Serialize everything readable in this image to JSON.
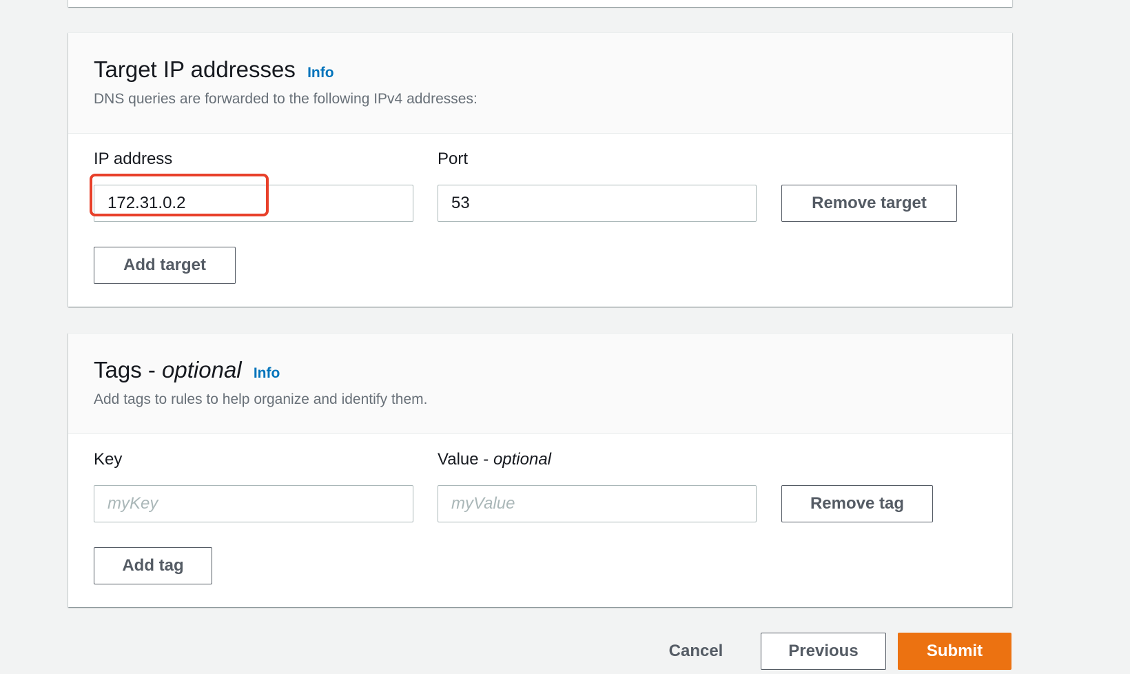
{
  "targets_panel": {
    "title": "Target IP addresses",
    "info_label": "Info",
    "description": "DNS queries are forwarded to the following IPv4 addresses:",
    "ip_label": "IP address",
    "ip_value": "172.31.0.2",
    "port_label": "Port",
    "port_value": "53",
    "remove_button": "Remove target",
    "add_button": "Add target"
  },
  "tags_panel": {
    "title_main": "Tags - ",
    "title_optional": "optional",
    "info_label": "Info",
    "description": "Add tags to rules to help organize and identify them.",
    "key_label": "Key",
    "key_placeholder": "myKey",
    "value_label_main": "Value - ",
    "value_label_optional": "optional",
    "value_placeholder": "myValue",
    "remove_button": "Remove tag",
    "add_button": "Add tag"
  },
  "footer": {
    "cancel_label": "Cancel",
    "previous_label": "Previous",
    "submit_label": "Submit"
  },
  "colors": {
    "accent_link": "#0073bb",
    "submit_orange": "#ec7211",
    "highlight_red": "#e8402a",
    "page_bg": "#f2f3f3"
  }
}
